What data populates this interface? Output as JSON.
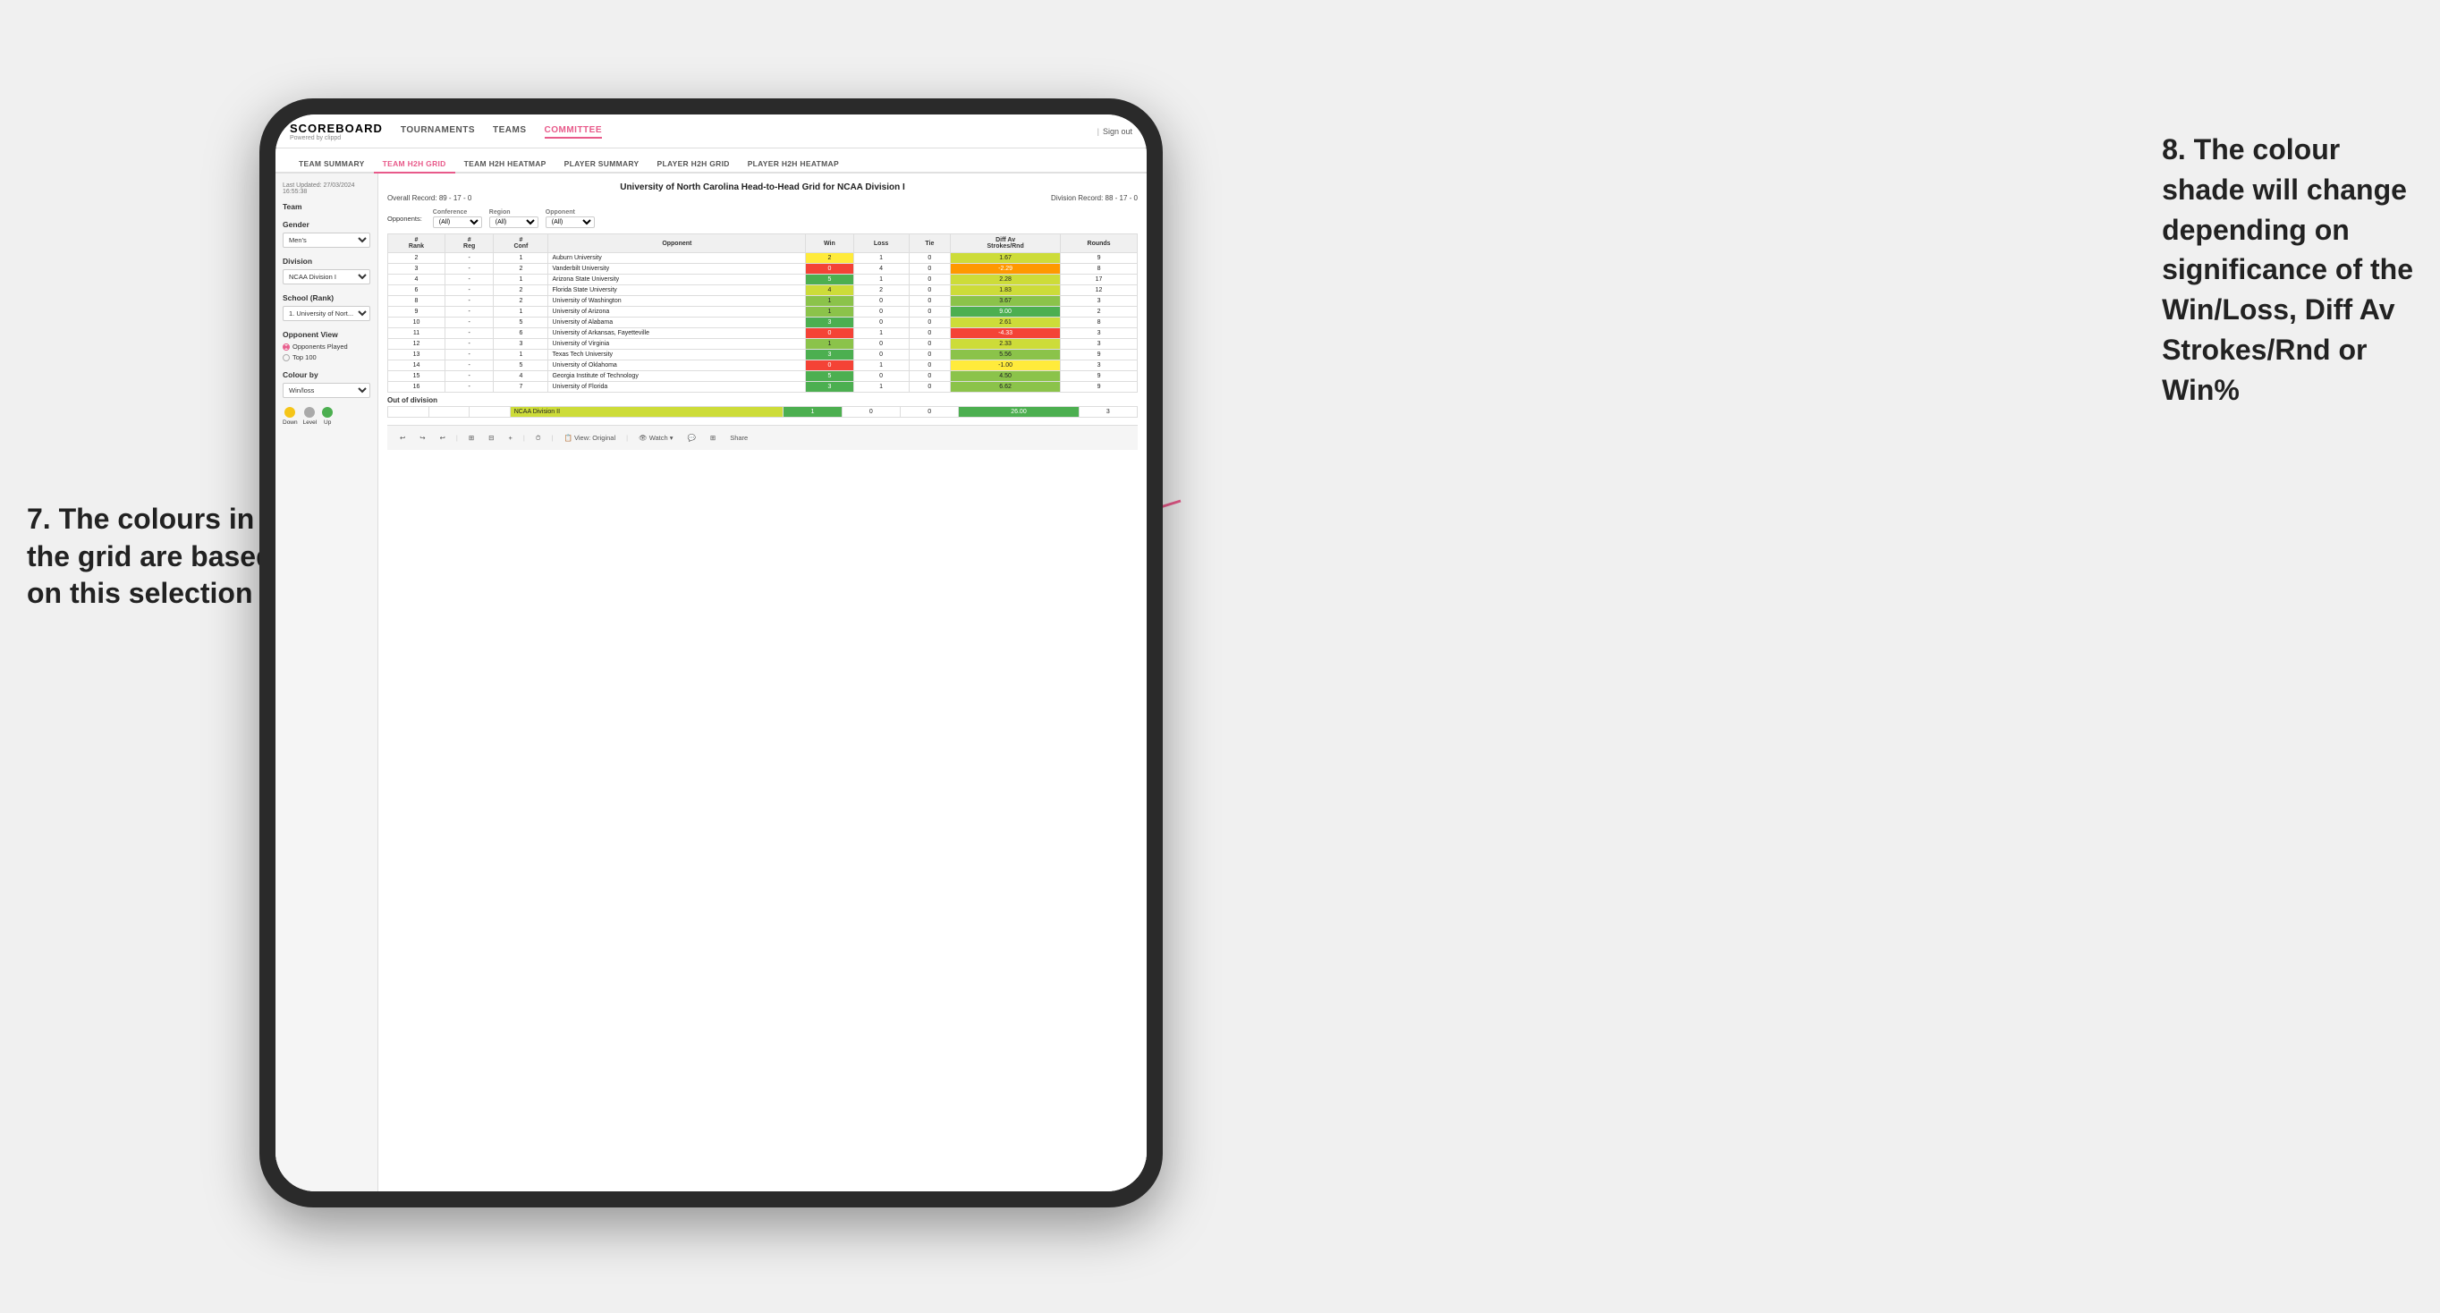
{
  "page": {
    "background": "#f0f0f0"
  },
  "annotations": {
    "left_title": "7. The colours in\nthe grid are based\non this selection",
    "right_title": "8. The colour\nshade will change\ndepending on\nsignificance of the\nWin/Loss, Diff Av\nStrokes/Rnd or\nWin%"
  },
  "nav": {
    "logo": "SCOREBOARD",
    "logo_sub": "Powered by clippd",
    "items": [
      "TOURNAMENTS",
      "TEAMS",
      "COMMITTEE"
    ],
    "sign_out": "Sign out"
  },
  "sub_nav": {
    "items": [
      "TEAM SUMMARY",
      "TEAM H2H GRID",
      "TEAM H2H HEATMAP",
      "PLAYER SUMMARY",
      "PLAYER H2H GRID",
      "PLAYER H2H HEATMAP"
    ],
    "active": "TEAM H2H GRID"
  },
  "sidebar": {
    "timestamp_label": "Last Updated: 27/03/2024",
    "timestamp_time": "16:55:38",
    "team_label": "Team",
    "gender_label": "Gender",
    "gender_value": "Men's",
    "division_label": "Division",
    "division_value": "NCAA Division I",
    "school_label": "School (Rank)",
    "school_value": "1. University of Nort...",
    "opponent_view_label": "Opponent View",
    "radio_options": [
      "Opponents Played",
      "Top 100"
    ],
    "radio_selected": "Opponents Played",
    "colour_by_label": "Colour by",
    "colour_by_value": "Win/loss",
    "legend": [
      {
        "label": "Down",
        "color": "#f44336"
      },
      {
        "label": "Level",
        "color": "#aaaaaa"
      },
      {
        "label": "Up",
        "color": "#4caf50"
      }
    ]
  },
  "grid": {
    "title": "University of North Carolina Head-to-Head Grid for NCAA Division I",
    "overall_record_label": "Overall Record:",
    "overall_record_value": "89 - 17 - 0",
    "division_record_label": "Division Record:",
    "division_record_value": "88 - 17 - 0",
    "filters": {
      "opponents_label": "Opponents:",
      "conference_label": "Conference",
      "conference_value": "(All)",
      "region_label": "Region",
      "region_value": "(All)",
      "opponent_label": "Opponent",
      "opponent_value": "(All)"
    },
    "columns": [
      "#\nRank",
      "#\nReg",
      "#\nConf",
      "Opponent",
      "Win",
      "Loss",
      "Tie",
      "Diff Av\nStrokes/Rnd",
      "Rounds"
    ],
    "rows": [
      {
        "rank": "2",
        "reg": "-",
        "conf": "1",
        "opponent": "Auburn University",
        "win": "2",
        "loss": "1",
        "tie": "0",
        "diff": "1.67",
        "rounds": "9",
        "win_color": "yellow",
        "diff_color": "green_light"
      },
      {
        "rank": "3",
        "reg": "-",
        "conf": "2",
        "opponent": "Vanderbilt University",
        "win": "0",
        "loss": "4",
        "tie": "0",
        "diff": "-2.29",
        "rounds": "8",
        "win_color": "red",
        "diff_color": "orange"
      },
      {
        "rank": "4",
        "reg": "-",
        "conf": "1",
        "opponent": "Arizona State University",
        "win": "5",
        "loss": "1",
        "tie": "0",
        "diff": "2.28",
        "rounds": "17",
        "win_color": "green_dark",
        "diff_color": "green_light"
      },
      {
        "rank": "6",
        "reg": "-",
        "conf": "2",
        "opponent": "Florida State University",
        "win": "4",
        "loss": "2",
        "tie": "0",
        "diff": "1.83",
        "rounds": "12",
        "win_color": "green_light",
        "diff_color": "green_light"
      },
      {
        "rank": "8",
        "reg": "-",
        "conf": "2",
        "opponent": "University of Washington",
        "win": "1",
        "loss": "0",
        "tie": "0",
        "diff": "3.67",
        "rounds": "3",
        "win_color": "green_mid",
        "diff_color": "green_mid"
      },
      {
        "rank": "9",
        "reg": "-",
        "conf": "1",
        "opponent": "University of Arizona",
        "win": "1",
        "loss": "0",
        "tie": "0",
        "diff": "9.00",
        "rounds": "2",
        "win_color": "green_mid",
        "diff_color": "green_dark"
      },
      {
        "rank": "10",
        "reg": "-",
        "conf": "5",
        "opponent": "University of Alabama",
        "win": "3",
        "loss": "0",
        "tie": "0",
        "diff": "2.61",
        "rounds": "8",
        "win_color": "green_dark",
        "diff_color": "green_light"
      },
      {
        "rank": "11",
        "reg": "-",
        "conf": "6",
        "opponent": "University of Arkansas, Fayetteville",
        "win": "0",
        "loss": "1",
        "tie": "0",
        "diff": "-4.33",
        "rounds": "3",
        "win_color": "red",
        "diff_color": "red"
      },
      {
        "rank": "12",
        "reg": "-",
        "conf": "3",
        "opponent": "University of Virginia",
        "win": "1",
        "loss": "0",
        "tie": "0",
        "diff": "2.33",
        "rounds": "3",
        "win_color": "green_mid",
        "diff_color": "green_light"
      },
      {
        "rank": "13",
        "reg": "-",
        "conf": "1",
        "opponent": "Texas Tech University",
        "win": "3",
        "loss": "0",
        "tie": "0",
        "diff": "5.56",
        "rounds": "9",
        "win_color": "green_dark",
        "diff_color": "green_mid"
      },
      {
        "rank": "14",
        "reg": "-",
        "conf": "5",
        "opponent": "University of Oklahoma",
        "win": "0",
        "loss": "1",
        "tie": "0",
        "diff": "-1.00",
        "rounds": "3",
        "win_color": "red",
        "diff_color": "yellow"
      },
      {
        "rank": "15",
        "reg": "-",
        "conf": "4",
        "opponent": "Georgia Institute of Technology",
        "win": "5",
        "loss": "0",
        "tie": "0",
        "diff": "4.50",
        "rounds": "9",
        "win_color": "green_dark",
        "diff_color": "green_mid"
      },
      {
        "rank": "16",
        "reg": "-",
        "conf": "7",
        "opponent": "University of Florida",
        "win": "3",
        "loss": "1",
        "tie": "0",
        "diff": "6.62",
        "rounds": "9",
        "win_color": "green_dark",
        "diff_color": "green_mid"
      }
    ],
    "out_of_division_label": "Out of division",
    "out_of_division_rows": [
      {
        "opponent": "NCAA Division II",
        "win": "1",
        "loss": "0",
        "tie": "0",
        "diff": "26.00",
        "rounds": "3",
        "win_color": "green_dark",
        "diff_color": "green_dark"
      }
    ]
  },
  "toolbar": {
    "buttons": [
      "↩",
      "↪",
      "↩",
      "⊞",
      "⊟",
      "+",
      "⏱",
      "View: Original",
      "👁 Watch ▾",
      "🗪",
      "⊞",
      "Share"
    ]
  }
}
